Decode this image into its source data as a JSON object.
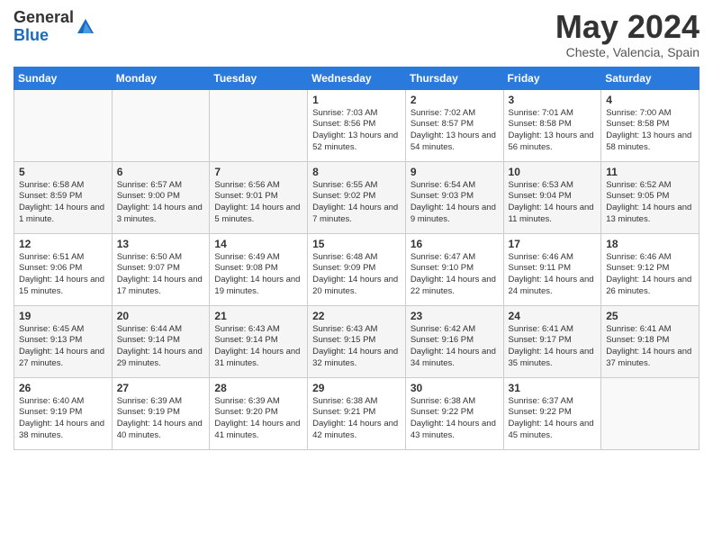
{
  "header": {
    "logo_general": "General",
    "logo_blue": "Blue",
    "title": "May 2024",
    "subtitle": "Cheste, Valencia, Spain"
  },
  "days_of_week": [
    "Sunday",
    "Monday",
    "Tuesday",
    "Wednesday",
    "Thursday",
    "Friday",
    "Saturday"
  ],
  "weeks": [
    [
      {
        "day": "",
        "info": ""
      },
      {
        "day": "",
        "info": ""
      },
      {
        "day": "",
        "info": ""
      },
      {
        "day": "1",
        "info": "Sunrise: 7:03 AM\nSunset: 8:56 PM\nDaylight: 13 hours\nand 52 minutes."
      },
      {
        "day": "2",
        "info": "Sunrise: 7:02 AM\nSunset: 8:57 PM\nDaylight: 13 hours\nand 54 minutes."
      },
      {
        "day": "3",
        "info": "Sunrise: 7:01 AM\nSunset: 8:58 PM\nDaylight: 13 hours\nand 56 minutes."
      },
      {
        "day": "4",
        "info": "Sunrise: 7:00 AM\nSunset: 8:58 PM\nDaylight: 13 hours\nand 58 minutes."
      }
    ],
    [
      {
        "day": "5",
        "info": "Sunrise: 6:58 AM\nSunset: 8:59 PM\nDaylight: 14 hours\nand 1 minute."
      },
      {
        "day": "6",
        "info": "Sunrise: 6:57 AM\nSunset: 9:00 PM\nDaylight: 14 hours\nand 3 minutes."
      },
      {
        "day": "7",
        "info": "Sunrise: 6:56 AM\nSunset: 9:01 PM\nDaylight: 14 hours\nand 5 minutes."
      },
      {
        "day": "8",
        "info": "Sunrise: 6:55 AM\nSunset: 9:02 PM\nDaylight: 14 hours\nand 7 minutes."
      },
      {
        "day": "9",
        "info": "Sunrise: 6:54 AM\nSunset: 9:03 PM\nDaylight: 14 hours\nand 9 minutes."
      },
      {
        "day": "10",
        "info": "Sunrise: 6:53 AM\nSunset: 9:04 PM\nDaylight: 14 hours\nand 11 minutes."
      },
      {
        "day": "11",
        "info": "Sunrise: 6:52 AM\nSunset: 9:05 PM\nDaylight: 14 hours\nand 13 minutes."
      }
    ],
    [
      {
        "day": "12",
        "info": "Sunrise: 6:51 AM\nSunset: 9:06 PM\nDaylight: 14 hours\nand 15 minutes."
      },
      {
        "day": "13",
        "info": "Sunrise: 6:50 AM\nSunset: 9:07 PM\nDaylight: 14 hours\nand 17 minutes."
      },
      {
        "day": "14",
        "info": "Sunrise: 6:49 AM\nSunset: 9:08 PM\nDaylight: 14 hours\nand 19 minutes."
      },
      {
        "day": "15",
        "info": "Sunrise: 6:48 AM\nSunset: 9:09 PM\nDaylight: 14 hours\nand 20 minutes."
      },
      {
        "day": "16",
        "info": "Sunrise: 6:47 AM\nSunset: 9:10 PM\nDaylight: 14 hours\nand 22 minutes."
      },
      {
        "day": "17",
        "info": "Sunrise: 6:46 AM\nSunset: 9:11 PM\nDaylight: 14 hours\nand 24 minutes."
      },
      {
        "day": "18",
        "info": "Sunrise: 6:46 AM\nSunset: 9:12 PM\nDaylight: 14 hours\nand 26 minutes."
      }
    ],
    [
      {
        "day": "19",
        "info": "Sunrise: 6:45 AM\nSunset: 9:13 PM\nDaylight: 14 hours\nand 27 minutes."
      },
      {
        "day": "20",
        "info": "Sunrise: 6:44 AM\nSunset: 9:14 PM\nDaylight: 14 hours\nand 29 minutes."
      },
      {
        "day": "21",
        "info": "Sunrise: 6:43 AM\nSunset: 9:14 PM\nDaylight: 14 hours\nand 31 minutes."
      },
      {
        "day": "22",
        "info": "Sunrise: 6:43 AM\nSunset: 9:15 PM\nDaylight: 14 hours\nand 32 minutes."
      },
      {
        "day": "23",
        "info": "Sunrise: 6:42 AM\nSunset: 9:16 PM\nDaylight: 14 hours\nand 34 minutes."
      },
      {
        "day": "24",
        "info": "Sunrise: 6:41 AM\nSunset: 9:17 PM\nDaylight: 14 hours\nand 35 minutes."
      },
      {
        "day": "25",
        "info": "Sunrise: 6:41 AM\nSunset: 9:18 PM\nDaylight: 14 hours\nand 37 minutes."
      }
    ],
    [
      {
        "day": "26",
        "info": "Sunrise: 6:40 AM\nSunset: 9:19 PM\nDaylight: 14 hours\nand 38 minutes."
      },
      {
        "day": "27",
        "info": "Sunrise: 6:39 AM\nSunset: 9:19 PM\nDaylight: 14 hours\nand 40 minutes."
      },
      {
        "day": "28",
        "info": "Sunrise: 6:39 AM\nSunset: 9:20 PM\nDaylight: 14 hours\nand 41 minutes."
      },
      {
        "day": "29",
        "info": "Sunrise: 6:38 AM\nSunset: 9:21 PM\nDaylight: 14 hours\nand 42 minutes."
      },
      {
        "day": "30",
        "info": "Sunrise: 6:38 AM\nSunset: 9:22 PM\nDaylight: 14 hours\nand 43 minutes."
      },
      {
        "day": "31",
        "info": "Sunrise: 6:37 AM\nSunset: 9:22 PM\nDaylight: 14 hours\nand 45 minutes."
      },
      {
        "day": "",
        "info": ""
      }
    ]
  ]
}
